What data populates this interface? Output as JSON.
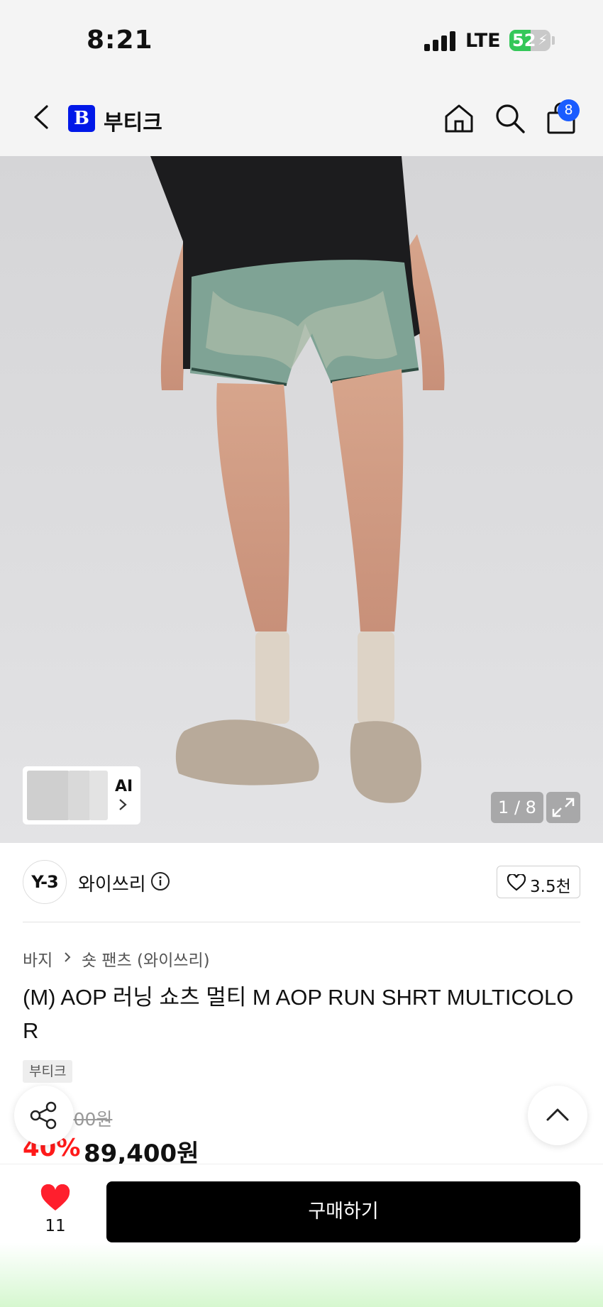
{
  "status_bar": {
    "time": "8:21",
    "network": "LTE",
    "battery": "52",
    "battery_level": 0.52
  },
  "header": {
    "store_logo": "B",
    "store_name": "부티크",
    "cart_count": "8"
  },
  "gallery": {
    "ai_label": "AI",
    "counter": "1 / 8"
  },
  "brand": {
    "logo_text": "Y-3",
    "name": "와이쓰리",
    "likes": "3.5천"
  },
  "product": {
    "breadcrumb": [
      "바지",
      "숏 팬츠 (와이쓰리)"
    ],
    "title": "(M) AOP 러닝 쇼츠 멀티 M AOP RUN SHRT MULTICOLOR",
    "tag": "부티크",
    "original_price": "149,000원",
    "discount": "40%",
    "price": "89,400원"
  },
  "bottom_bar": {
    "like_count": "11",
    "buy_label": "구매하기"
  },
  "icons": [
    "back-icon",
    "home-icon",
    "search-icon",
    "bag-icon",
    "expand-icon",
    "info-icon",
    "heart-outline-icon",
    "share-icon",
    "chevron-up-icon",
    "heart-filled-icon"
  ],
  "colors": {
    "accent_blue": "#0018e8",
    "badge_blue": "#1a5cff",
    "discount_red": "#ff1a1a",
    "buy_button": "#000000"
  }
}
